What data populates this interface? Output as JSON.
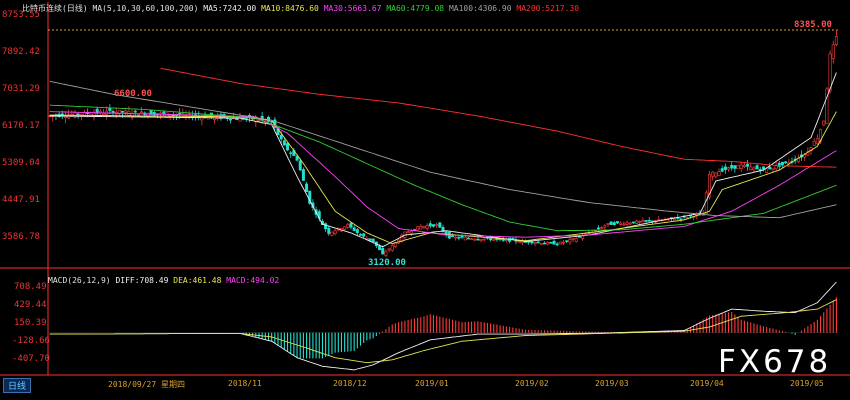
{
  "header": {
    "title": "比特币连续(日线)",
    "params": "MA(5,10,30,60,100,200)",
    "ma5": "MA5:7242.00",
    "ma10": "MA10:8476.60",
    "ma30": "MA30:5663.67",
    "ma60": "MA60:4779.08",
    "ma100": "MA100:4306.90",
    "ma200": "MA200:5217.30"
  },
  "macd_header": {
    "title": "MACD(26,12,9)",
    "diff": "DIFF:708.49",
    "dea": "DEA:461.48",
    "macd": "MACD:494.02"
  },
  "annotations": {
    "high": "8385.00",
    "peak_mid": "6600.00",
    "low": "3120.00"
  },
  "price_axis": [
    "8753.55",
    "7892.42",
    "7031.29",
    "6170.17",
    "5309.04",
    "4447.91",
    "3586.78"
  ],
  "macd_axis": [
    "708.49",
    "429.44",
    "150.39",
    "-128.66",
    "-407.70"
  ],
  "x_axis": [
    "2018/09/27 星期四",
    "2018/11",
    "2018/12",
    "2019/01",
    "2019/02",
    "2019/03",
    "2019/04",
    "2019/05"
  ],
  "footer": {
    "tab_label": "日线"
  },
  "watermark": "FX678",
  "colors": {
    "bg": "#000000",
    "up": "#ff3b3b",
    "down": "#20e0d0",
    "ma5": "#f0f0f0",
    "ma10": "#e6e650",
    "ma30": "#ff40ff",
    "ma60": "#30d030",
    "ma100": "#a0a0a0",
    "ma200": "#ff3030",
    "diff": "#f0f0f0",
    "dea": "#e6e650",
    "axis": "#ff3030"
  },
  "chart_data": {
    "type": "candlestick",
    "price_range": [
      3120,
      8753.55
    ],
    "macd_range": [
      -550,
      708.49
    ],
    "ma_legend": [
      "MA5",
      "MA10",
      "MA30",
      "MA60",
      "MA100",
      "MA200"
    ],
    "price_anchors": [
      [
        0,
        6400
      ],
      [
        10,
        6450
      ],
      [
        20,
        6500
      ],
      [
        35,
        6450
      ],
      [
        50,
        6380
      ],
      [
        65,
        6330
      ],
      [
        70,
        6250
      ],
      [
        74,
        5700
      ],
      [
        78,
        5400
      ],
      [
        82,
        4400
      ],
      [
        86,
        3900
      ],
      [
        88,
        3700
      ],
      [
        94,
        3880
      ],
      [
        98,
        3650
      ],
      [
        102,
        3500
      ],
      [
        105,
        3200
      ],
      [
        108,
        3400
      ],
      [
        112,
        3700
      ],
      [
        117,
        3850
      ],
      [
        122,
        3880
      ],
      [
        126,
        3600
      ],
      [
        132,
        3580
      ],
      [
        140,
        3550
      ],
      [
        150,
        3500
      ],
      [
        160,
        3450
      ],
      [
        165,
        3550
      ],
      [
        170,
        3700
      ],
      [
        176,
        3900
      ],
      [
        185,
        3950
      ],
      [
        193,
        4000
      ],
      [
        200,
        4050
      ],
      [
        206,
        4150
      ],
      [
        208,
        5050
      ],
      [
        212,
        5150
      ],
      [
        218,
        5250
      ],
      [
        225,
        5150
      ],
      [
        232,
        5300
      ],
      [
        238,
        5500
      ],
      [
        242,
        5900
      ],
      [
        244,
        6300
      ],
      [
        246,
        7800
      ],
      [
        248,
        8200
      ]
    ],
    "ma_anchors": {
      "MA5": [
        [
          0,
          6400
        ],
        [
          60,
          6350
        ],
        [
          70,
          6200
        ],
        [
          78,
          5000
        ],
        [
          86,
          3900
        ],
        [
          95,
          3700
        ],
        [
          105,
          3380
        ],
        [
          112,
          3650
        ],
        [
          125,
          3750
        ],
        [
          150,
          3500
        ],
        [
          170,
          3650
        ],
        [
          190,
          3950
        ],
        [
          205,
          4150
        ],
        [
          210,
          4900
        ],
        [
          225,
          5150
        ],
        [
          240,
          5900
        ],
        [
          248,
          7400
        ]
      ],
      "MA10": [
        [
          0,
          6420
        ],
        [
          60,
          6380
        ],
        [
          70,
          6300
        ],
        [
          80,
          5300
        ],
        [
          90,
          4200
        ],
        [
          100,
          3700
        ],
        [
          108,
          3450
        ],
        [
          120,
          3700
        ],
        [
          150,
          3520
        ],
        [
          175,
          3750
        ],
        [
          200,
          4000
        ],
        [
          208,
          4200
        ],
        [
          212,
          4700
        ],
        [
          230,
          5150
        ],
        [
          242,
          5700
        ],
        [
          248,
          6500
        ]
      ],
      "MA30": [
        [
          0,
          6500
        ],
        [
          40,
          6430
        ],
        [
          65,
          6380
        ],
        [
          75,
          6000
        ],
        [
          90,
          5000
        ],
        [
          100,
          4300
        ],
        [
          110,
          3800
        ],
        [
          125,
          3650
        ],
        [
          150,
          3600
        ],
        [
          170,
          3650
        ],
        [
          200,
          3850
        ],
        [
          215,
          4200
        ],
        [
          230,
          4800
        ],
        [
          248,
          5600
        ]
      ],
      "MA60": [
        [
          0,
          6650
        ],
        [
          30,
          6550
        ],
        [
          65,
          6350
        ],
        [
          85,
          5800
        ],
        [
          100,
          5300
        ],
        [
          115,
          4800
        ],
        [
          130,
          4350
        ],
        [
          145,
          3950
        ],
        [
          160,
          3750
        ],
        [
          180,
          3770
        ],
        [
          200,
          3900
        ],
        [
          225,
          4150
        ],
        [
          248,
          4800
        ]
      ],
      "MA100": [
        [
          0,
          7200
        ],
        [
          20,
          6900
        ],
        [
          45,
          6600
        ],
        [
          70,
          6300
        ],
        [
          95,
          5700
        ],
        [
          120,
          5100
        ],
        [
          145,
          4700
        ],
        [
          170,
          4400
        ],
        [
          195,
          4200
        ],
        [
          210,
          4100
        ],
        [
          230,
          4050
        ],
        [
          248,
          4350
        ]
      ],
      "MA200": [
        [
          35,
          7500
        ],
        [
          60,
          7150
        ],
        [
          85,
          6900
        ],
        [
          110,
          6700
        ],
        [
          135,
          6400
        ],
        [
          160,
          6050
        ],
        [
          180,
          5700
        ],
        [
          200,
          5400
        ],
        [
          215,
          5350
        ],
        [
          230,
          5250
        ],
        [
          248,
          5217
        ]
      ]
    },
    "macd_anchors": {
      "DIFF": [
        [
          0,
          -20
        ],
        [
          60,
          -10
        ],
        [
          70,
          -120
        ],
        [
          78,
          -350
        ],
        [
          86,
          -470
        ],
        [
          96,
          -520
        ],
        [
          102,
          -450
        ],
        [
          110,
          -280
        ],
        [
          120,
          -100
        ],
        [
          135,
          -20
        ],
        [
          150,
          -20
        ],
        [
          175,
          -5
        ],
        [
          200,
          30
        ],
        [
          208,
          200
        ],
        [
          215,
          330
        ],
        [
          225,
          300
        ],
        [
          235,
          280
        ],
        [
          242,
          420
        ],
        [
          248,
          708.49
        ]
      ],
      "DEA": [
        [
          0,
          -20
        ],
        [
          60,
          -10
        ],
        [
          70,
          -60
        ],
        [
          80,
          -200
        ],
        [
          90,
          -350
        ],
        [
          100,
          -420
        ],
        [
          108,
          -380
        ],
        [
          118,
          -250
        ],
        [
          130,
          -120
        ],
        [
          150,
          -40
        ],
        [
          175,
          -10
        ],
        [
          200,
          20
        ],
        [
          208,
          80
        ],
        [
          218,
          230
        ],
        [
          232,
          280
        ],
        [
          242,
          330
        ],
        [
          248,
          461.48
        ]
      ]
    },
    "x_tick_labels": [
      "2018/09/27 星期四",
      "2018/11",
      "2018/12",
      "2019/01",
      "2019/02",
      "2019/03",
      "2019/04",
      "2019/05"
    ],
    "price_ticks": [
      8753.55,
      7892.42,
      7031.29,
      6170.17,
      5309.04,
      4447.91,
      3586.78
    ],
    "macd_ticks": [
      708.49,
      429.44,
      150.39,
      -128.66,
      -407.7
    ]
  }
}
